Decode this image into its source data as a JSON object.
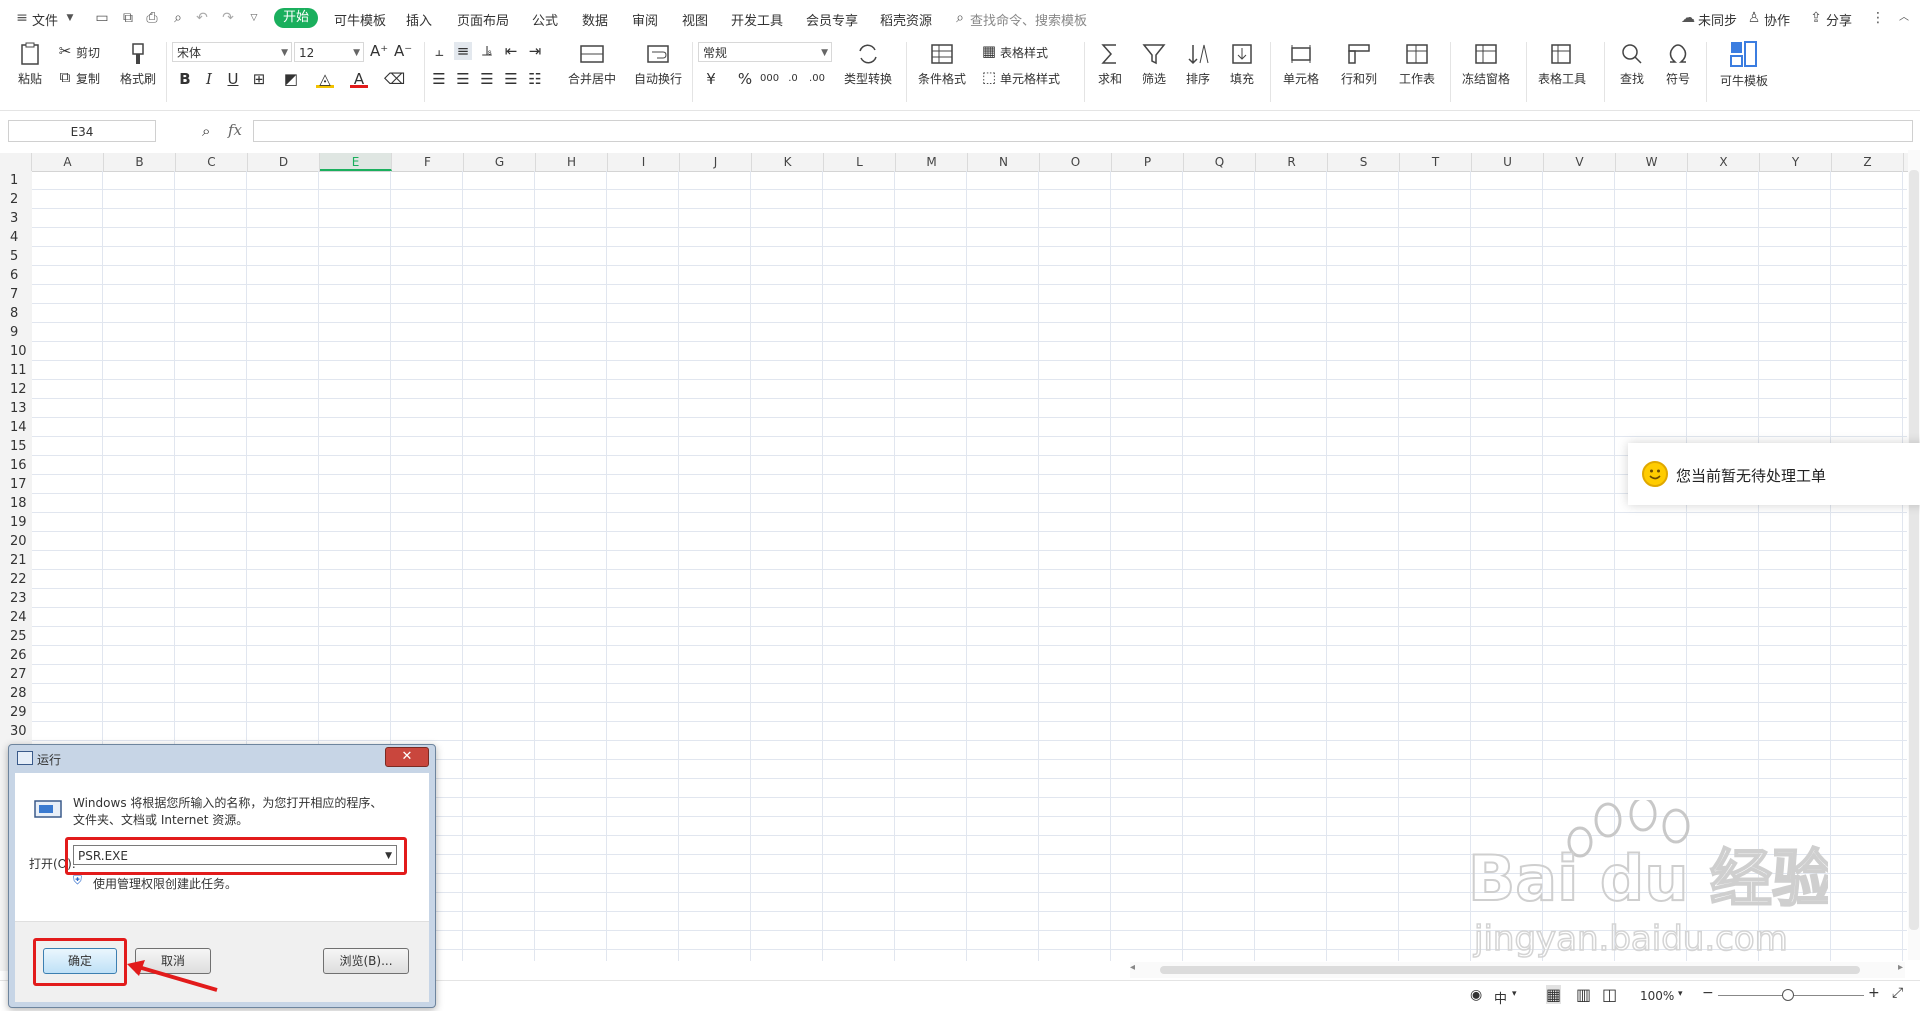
{
  "menubar": {
    "file_label": "文件",
    "tabs": [
      "开始",
      "可牛模板",
      "插入",
      "页面布局",
      "公式",
      "数据",
      "审阅",
      "视图",
      "开发工具",
      "会员专享",
      "稻壳资源"
    ],
    "search_placeholder": "查找命令、搜索模板",
    "sync": "未同步",
    "collab": "协作",
    "share": "分享"
  },
  "ribbon": {
    "paste": "粘贴",
    "cut": "剪切",
    "copy": "复制",
    "format_painter": "格式刷",
    "font_name": "宋体",
    "font_size": "12",
    "merge_center": "合并居中",
    "wrap_text": "自动换行",
    "number_format": "常规",
    "type_convert": "类型转换",
    "conditional_format": "条件格式",
    "table_style": "表格样式",
    "cell_style": "单元格样式",
    "sum": "求和",
    "filter": "筛选",
    "sort": "排序",
    "fill": "填充",
    "cell": "单元格",
    "row_col": "行和列",
    "worksheet": "工作表",
    "freeze": "冻结窗格",
    "table_tools": "表格工具",
    "find": "查找",
    "symbol": "符号",
    "keniu_template": "可牛模板"
  },
  "formulabar": {
    "cell_ref": "E34",
    "fx": "fx"
  },
  "grid": {
    "columns": [
      "A",
      "B",
      "C",
      "D",
      "E",
      "F",
      "G",
      "H",
      "I",
      "J",
      "K",
      "L",
      "M",
      "N",
      "O",
      "P",
      "Q",
      "R",
      "S",
      "T",
      "U",
      "V",
      "W",
      "X",
      "Y",
      "Z"
    ],
    "selected_column": "E",
    "rows": [
      "1",
      "2",
      "3",
      "4",
      "5",
      "6",
      "7",
      "8",
      "9",
      "10",
      "11",
      "12",
      "13",
      "14",
      "15",
      "16",
      "17",
      "18",
      "19",
      "20",
      "21",
      "22",
      "23",
      "24",
      "25",
      "26",
      "27",
      "28",
      "29",
      "30"
    ]
  },
  "notification": {
    "text": "您当前暂无待处理工单"
  },
  "run_dialog": {
    "title": "运行",
    "description_line1": "Windows 将根据您所输入的名称，为您打开相应的程序、",
    "description_line2": "文件夹、文档或 Internet 资源。",
    "open_label": "打开(O):",
    "input_value": "PSR.EXE",
    "admin_note": "使用管理权限创建此任务。",
    "ok": "确定",
    "cancel": "取消",
    "browse": "浏览(B)..."
  },
  "statusbar": {
    "lang": "中",
    "zoom": "100%"
  },
  "watermark": {
    "brand": "Bai du 经验",
    "url": "jingyan.baidu.com"
  },
  "colors": {
    "accent": "#1aaf5d",
    "highlight_red": "#e21b1b",
    "grid_line": "#e1e6ef"
  }
}
